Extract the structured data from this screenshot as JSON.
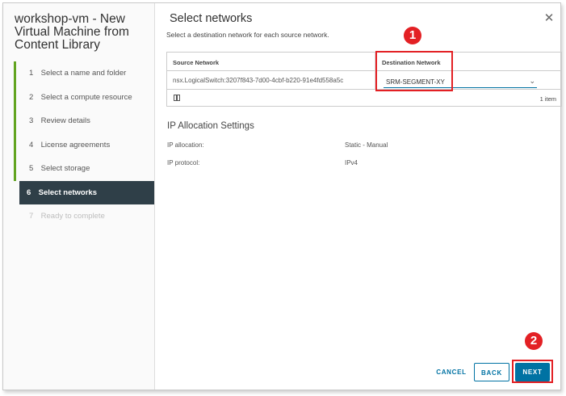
{
  "sidebar": {
    "title": "workshop-vm - New Virtual Machine from Content Library",
    "steps": [
      {
        "num": "1",
        "label": "Select a name and folder"
      },
      {
        "num": "2",
        "label": "Select a compute resource"
      },
      {
        "num": "3",
        "label": "Review details"
      },
      {
        "num": "4",
        "label": "License agreements"
      },
      {
        "num": "5",
        "label": "Select storage"
      },
      {
        "num": "6",
        "label": "Select networks"
      },
      {
        "num": "7",
        "label": "Ready to complete"
      }
    ]
  },
  "main": {
    "title": "Select networks",
    "subtitle": "Select a destination network for each source network.",
    "close_icon": "close-icon"
  },
  "grid": {
    "columns": [
      "Source Network",
      "Destination Network"
    ],
    "rows": [
      {
        "source": "nsx.LogicalSwitch:3207f843-7d00-4cbf-b220-91e4fd558a5c",
        "destination": "SRM-SEGMENT-XY"
      }
    ],
    "item_count": "1 item"
  },
  "ip_settings": {
    "title": "IP Allocation Settings",
    "rows": [
      {
        "label": "IP allocation:",
        "value": "Static - Manual"
      },
      {
        "label": "IP protocol:",
        "value": "IPv4"
      }
    ]
  },
  "footer": {
    "cancel": "CANCEL",
    "back": "BACK",
    "next": "NEXT"
  },
  "annotations": {
    "badge1": "1",
    "badge2": "2",
    "color": "#e32024"
  },
  "colors": {
    "accent": "#0072a3",
    "active_step_bg": "#2f3f48",
    "completed_step": "#62a420"
  }
}
